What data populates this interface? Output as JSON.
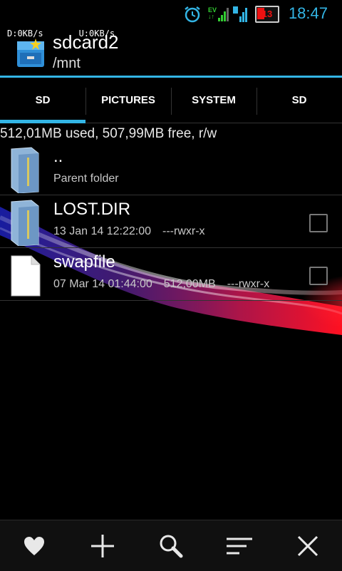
{
  "status_bar": {
    "time": "18:47",
    "battery_level": "13",
    "network_type": "EV",
    "icons": [
      "alarm-icon",
      "data-arrows-icon",
      "signal-icon",
      "battery-icon"
    ]
  },
  "net_speed": {
    "download": "D:0KB/s",
    "upload": "U:0KB/s"
  },
  "header": {
    "title": "sdcard2",
    "path": "/mnt"
  },
  "tabs": [
    {
      "label": "SD",
      "active": true
    },
    {
      "label": "PICTURES",
      "active": false
    },
    {
      "label": "SYSTEM",
      "active": false
    },
    {
      "label": "SD",
      "active": false
    }
  ],
  "storage_info": "512,01MB used, 507,99MB free, r/w",
  "files": [
    {
      "name": "..",
      "desc": "Parent folder",
      "type": "folder"
    },
    {
      "name": "LOST.DIR",
      "date": "13 Jan 14 12:22:00",
      "size": "",
      "perms": "---rwxr-x",
      "type": "folder"
    },
    {
      "name": "swapfile",
      "date": "07 Mar 14 01:44:00",
      "size": "512,00MB",
      "perms": "---rwxr-x",
      "type": "file"
    }
  ],
  "bottom_bar": [
    "favorites-heart-icon",
    "add-plus-icon",
    "search-icon",
    "sort-icon",
    "close-icon"
  ],
  "colors": {
    "accent": "#33b5e5",
    "background": "#000000"
  }
}
